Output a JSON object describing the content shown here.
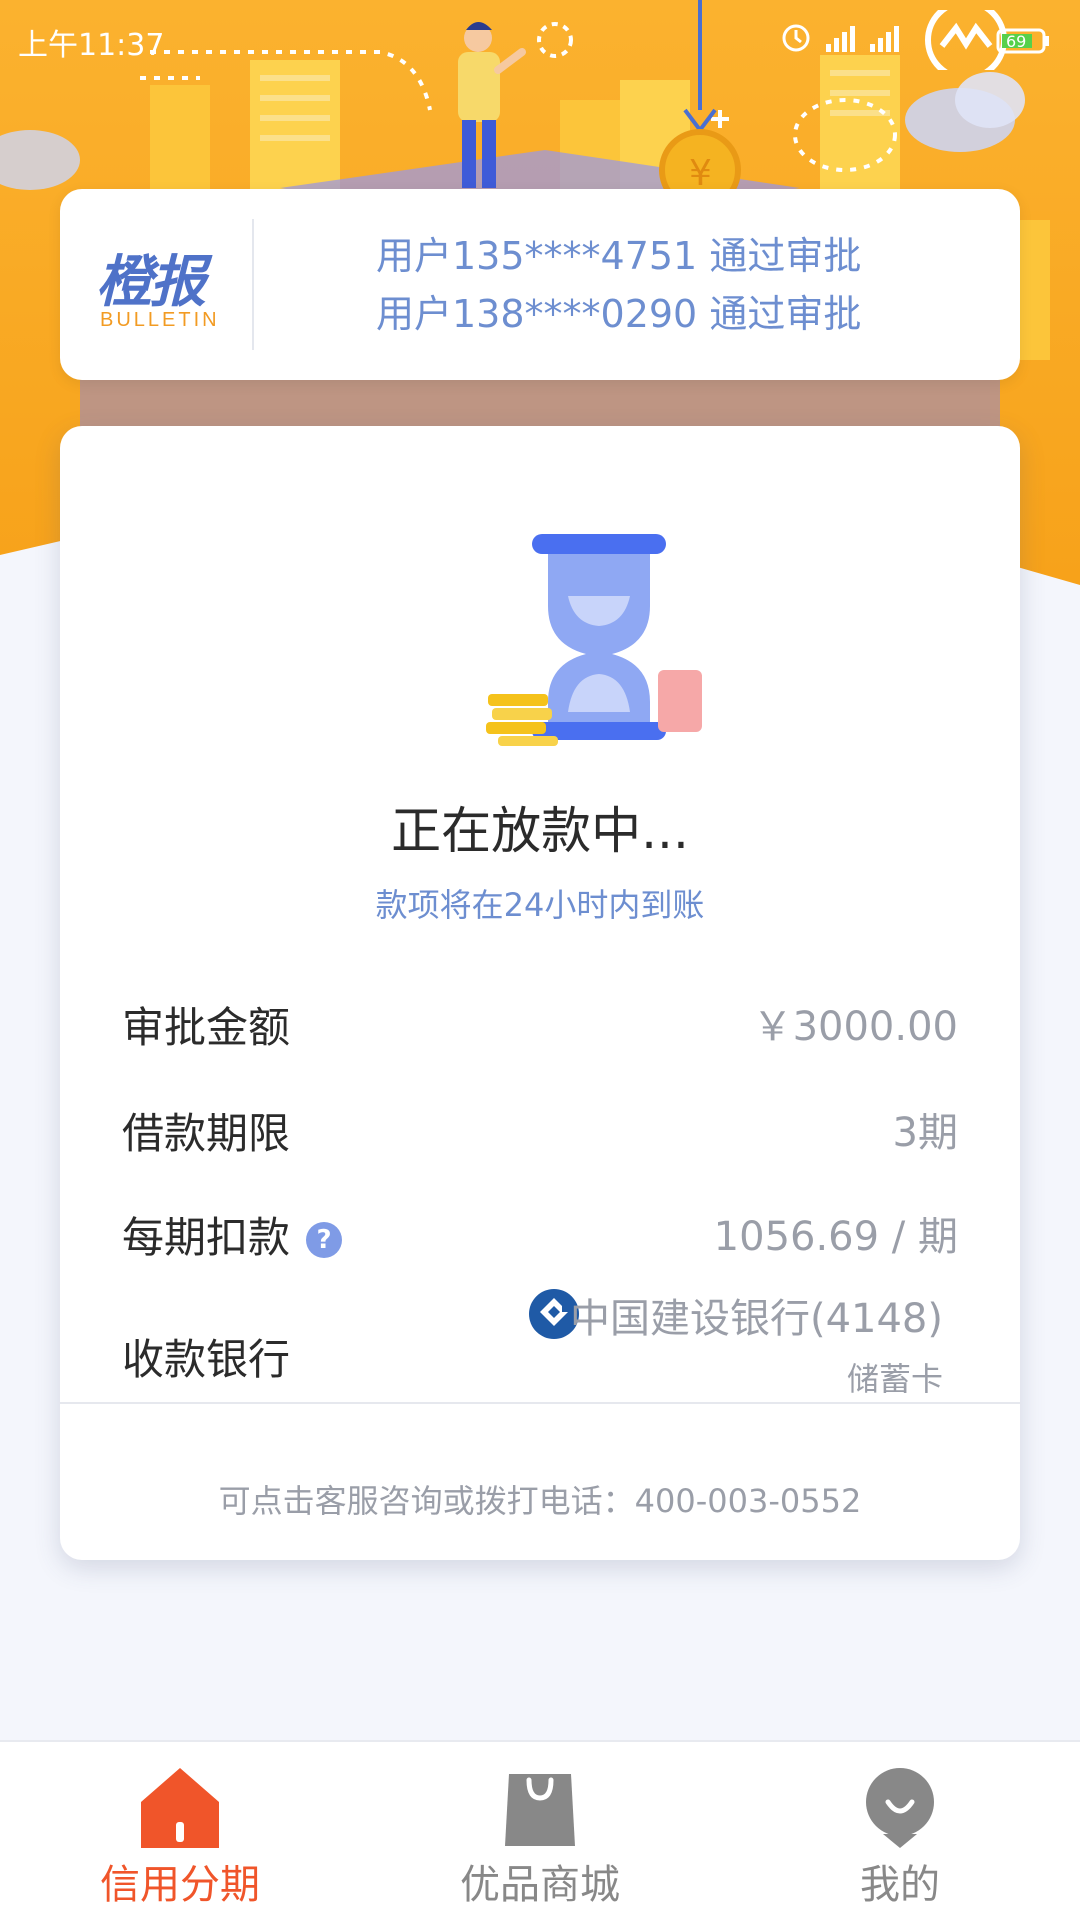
{
  "status_bar": {
    "time": "上午11:37",
    "battery": "69"
  },
  "bulletin": {
    "logo_title": "橙报",
    "logo_sub": "BULLETIN",
    "lines": [
      "用户135****4751 通过审批",
      "用户138****0290 通过审批"
    ]
  },
  "loan": {
    "status_title": "正在放款中...",
    "status_subtitle": "款项将在24小时内到账",
    "rows": [
      {
        "label": "审批金额",
        "value": "￥3000.00"
      },
      {
        "label": "借款期限",
        "value": "3期"
      },
      {
        "label": "每期扣款",
        "value": "1056.69 / 期",
        "help_icon": "?"
      }
    ],
    "bank": {
      "label": "收款银行",
      "name": "中国建设银行(4148)",
      "card_type": "储蓄卡"
    },
    "contact": "可点击客服咨询或拨打电话：400-003-0552"
  },
  "tabs": [
    {
      "label": "信用分期",
      "icon": "home-icon",
      "active": true
    },
    {
      "label": "优品商城",
      "icon": "shopping-bag-icon",
      "active": false
    },
    {
      "label": "我的",
      "icon": "profile-icon",
      "active": false
    }
  ],
  "colors": {
    "accent": "#f0552a",
    "brand_blue": "#4f72c8",
    "link_blue": "#6d8ed0",
    "hero_orange": "#f9a620"
  }
}
